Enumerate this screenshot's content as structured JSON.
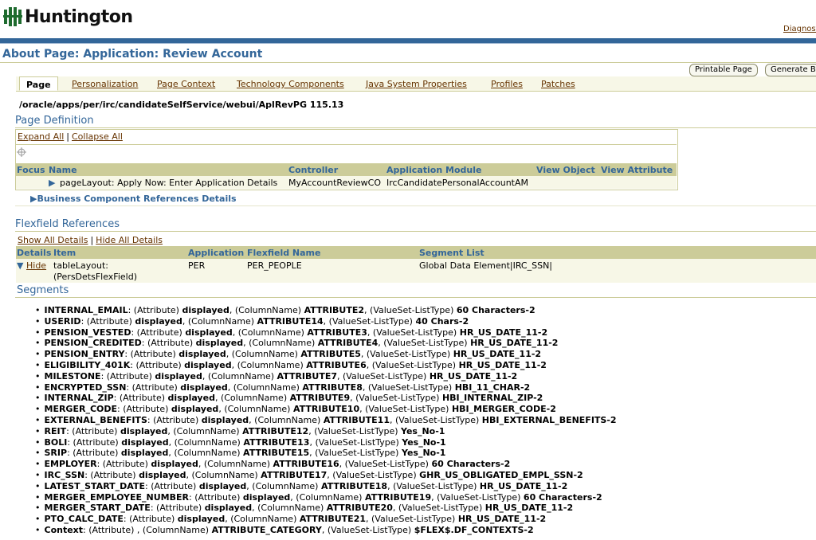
{
  "header": {
    "logo_text": "Huntington",
    "diagnostics_link": "Diagnost",
    "page_title": "About Page: Application: Review Account",
    "printable_button": "Printable Page",
    "generate_button": "Generate B"
  },
  "tabs": [
    {
      "label": "Page"
    },
    {
      "label": "Personalization"
    },
    {
      "label": "Page Context"
    },
    {
      "label": "Technology Components"
    },
    {
      "label": "Java System Properties"
    },
    {
      "label": "Profiles"
    },
    {
      "label": "Patches"
    }
  ],
  "page_path": "/oracle/apps/per/irc/candidateSelfService/webui/AplRevPG 115.13",
  "page_definition": {
    "title": "Page Definition",
    "expand_all": "Expand All",
    "collapse_all": "Collapse All",
    "separator": "|",
    "columns": [
      "Focus",
      "Name",
      "Controller",
      "Application Module",
      "View Object",
      "View Attribute"
    ],
    "row": {
      "name": "pageLayout: Apply Now: Enter Application Details",
      "controller": "MyAccountReviewCO",
      "app_module": "IrcCandidatePersonalAccountAM",
      "view_object": "",
      "view_attribute": ""
    },
    "bc_refs": "Business Component References Details"
  },
  "flexfield": {
    "title": "Flexfield References",
    "show_all": "Show All Details",
    "hide_all": "Hide All Details",
    "separator": "|",
    "columns": [
      "Details",
      "Item",
      "Application",
      "Flexfield Name",
      "Segment List"
    ],
    "row": {
      "details": "Hide",
      "item_line1": "tableLayout:",
      "item_line2": "(PersDetsFlexField)",
      "application": "PER",
      "flexfield_name": "PER_PEOPLE",
      "segment_list": "Global Data Element|IRC_SSN|"
    }
  },
  "segments": {
    "title": "Segments",
    "items": [
      {
        "name": "INTERNAL_EMAIL",
        "a": "(Attribute)",
        "disp": "displayed",
        "c": "(ColumnName)",
        "col": "ATTRIBUTE2",
        "v": "(ValueSet-ListType)",
        "vs": "60 Characters-2"
      },
      {
        "name": "USERID",
        "a": "(Attribute)",
        "disp": "displayed",
        "c": "(ColumnName)",
        "col": "ATTRIBUTE14",
        "v": "(ValueSet-ListType)",
        "vs": "40 Chars-2"
      },
      {
        "name": "PENSION_VESTED",
        "a": "(Attribute)",
        "disp": "displayed",
        "c": "(ColumnName)",
        "col": "ATTRIBUTE3",
        "v": "(ValueSet-ListType)",
        "vs": "HR_US_DATE_11-2"
      },
      {
        "name": "PENSION_CREDITED",
        "a": "(Attribute)",
        "disp": "displayed",
        "c": "(ColumnName)",
        "col": "ATTRIBUTE4",
        "v": "(ValueSet-ListType)",
        "vs": "HR_US_DATE_11-2"
      },
      {
        "name": "PENSION_ENTRY",
        "a": "(Attribute)",
        "disp": "displayed",
        "c": "(ColumnName)",
        "col": "ATTRIBUTE5",
        "v": "(ValueSet-ListType)",
        "vs": "HR_US_DATE_11-2"
      },
      {
        "name": "ELIGIBILITY_401K",
        "a": "(Attribute)",
        "disp": "displayed",
        "c": "(ColumnName)",
        "col": "ATTRIBUTE6",
        "v": "(ValueSet-ListType)",
        "vs": "HR_US_DATE_11-2"
      },
      {
        "name": "MILESTONE",
        "a": "(Attribute)",
        "disp": "displayed",
        "c": "(ColumnName)",
        "col": "ATTRIBUTE7",
        "v": "(ValueSet-ListType)",
        "vs": "HR_US_DATE_11-2"
      },
      {
        "name": "ENCRYPTED_SSN",
        "a": "(Attribute)",
        "disp": "displayed",
        "c": "(ColumnName)",
        "col": "ATTRIBUTE8",
        "v": "(ValueSet-ListType)",
        "vs": "HBI_11_CHAR-2"
      },
      {
        "name": "INTERNAL_ZIP",
        "a": "(Attribute)",
        "disp": "displayed",
        "c": "(ColumnName)",
        "col": "ATTRIBUTE9",
        "v": "(ValueSet-ListType)",
        "vs": "HBI_INTERNAL_ZIP-2"
      },
      {
        "name": "MERGER_CODE",
        "a": "(Attribute)",
        "disp": "displayed",
        "c": "(ColumnName)",
        "col": "ATTRIBUTE10",
        "v": "(ValueSet-ListType)",
        "vs": "HBI_MERGER_CODE-2"
      },
      {
        "name": "EXTERNAL_BENEFITS",
        "a": "(Attribute)",
        "disp": "displayed",
        "c": "(ColumnName)",
        "col": "ATTRIBUTE11",
        "v": "(ValueSet-ListType)",
        "vs": "HBI_EXTERNAL_BENEFITS-2"
      },
      {
        "name": "REIT",
        "a": "(Attribute)",
        "disp": "displayed",
        "c": "(ColumnName)",
        "col": "ATTRIBUTE12",
        "v": "(ValueSet-ListType)",
        "vs": "Yes_No-1"
      },
      {
        "name": "BOLI",
        "a": "(Attribute)",
        "disp": "displayed",
        "c": "(ColumnName)",
        "col": "ATTRIBUTE13",
        "v": "(ValueSet-ListType)",
        "vs": "Yes_No-1"
      },
      {
        "name": "SRIP",
        "a": "(Attribute)",
        "disp": "displayed",
        "c": "(ColumnName)",
        "col": "ATTRIBUTE15",
        "v": "(ValueSet-ListType)",
        "vs": "Yes_No-1"
      },
      {
        "name": "EMPLOYER",
        "a": "(Attribute)",
        "disp": "displayed",
        "c": "(ColumnName)",
        "col": "ATTRIBUTE16",
        "v": "(ValueSet-ListType)",
        "vs": "60 Characters-2"
      },
      {
        "name": "IRC_SSN",
        "a": "(Attribute)",
        "disp": "displayed",
        "c": "(ColumnName)",
        "col": "ATTRIBUTE17",
        "v": "(ValueSet-ListType)",
        "vs": "GHR_US_OBLIGATED_EMPL_SSN-2"
      },
      {
        "name": "LATEST_START_DATE",
        "a": "(Attribute)",
        "disp": "displayed",
        "c": "(ColumnName)",
        "col": "ATTRIBUTE18",
        "v": "(ValueSet-ListType)",
        "vs": "HR_US_DATE_11-2"
      },
      {
        "name": "MERGER_EMPLOYEE_NUMBER",
        "a": "(Attribute)",
        "disp": "displayed",
        "c": "(ColumnName)",
        "col": "ATTRIBUTE19",
        "v": "(ValueSet-ListType)",
        "vs": "60 Characters-2"
      },
      {
        "name": "MERGER_START_DATE",
        "a": "(Attribute)",
        "disp": "displayed",
        "c": "(ColumnName)",
        "col": "ATTRIBUTE20",
        "v": "(ValueSet-ListType)",
        "vs": "HR_US_DATE_11-2"
      },
      {
        "name": "PTO_CALC_DATE",
        "a": "(Attribute)",
        "disp": "displayed",
        "c": "(ColumnName)",
        "col": "ATTRIBUTE21",
        "v": "(ValueSet-ListType)",
        "vs": "HR_US_DATE_11-2"
      },
      {
        "name": "Context",
        "a": "(Attribute)",
        "disp": "",
        "c": "(ColumnName)",
        "col": "ATTRIBUTE_CATEGORY",
        "v": "(ValueSet-ListType)",
        "vs": "$FLEX$.DF_CONTEXTS-2"
      }
    ]
  },
  "colors": {
    "brand_blue": "#336699",
    "link_brown": "#663300",
    "header_tan": "#cccc99",
    "row_bg": "#f7f7e7",
    "logo_green": "#1e6b2e"
  }
}
